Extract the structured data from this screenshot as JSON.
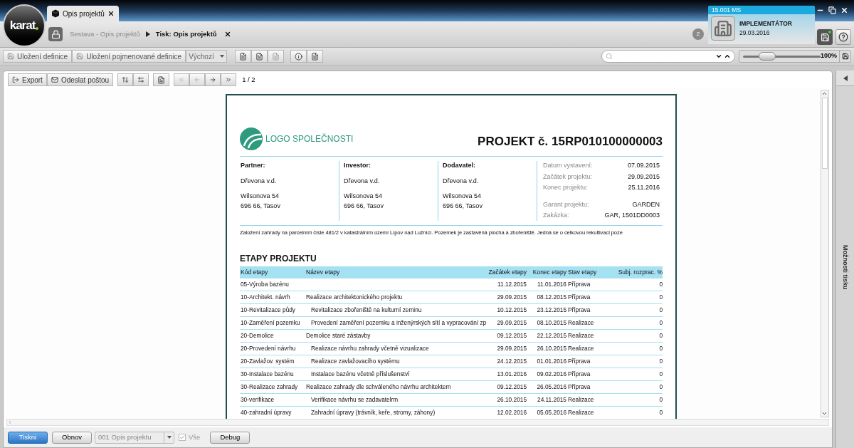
{
  "logo": {
    "text": "karat"
  },
  "tab": {
    "label": "Opis projektů",
    "selected": true
  },
  "breadcrumb": [
    {
      "label": "Sestava - Opis projektů",
      "selected": false
    },
    {
      "label": "Tisk: Opis projektů",
      "selected": true
    }
  ],
  "notifications": {
    "count": "2"
  },
  "user_panel": {
    "server": "15.001 MS",
    "role": "IMPLEMENTÁTOR",
    "date": "29.03.2016"
  },
  "toolbar": {
    "save_definition": "Uložení definice",
    "save_named_definition": "Uložení pojmenované definice",
    "preset": "Výchozí",
    "zoom": {
      "level": 0.25,
      "reading": "100%"
    }
  },
  "viewer_toolbar": {
    "export": "Export",
    "send_mail": "Odeslat poštou",
    "page": "1 / 2"
  },
  "document": {
    "logo_text": "LOGO SPOLEČNOSTI",
    "title": "PROJEKT č. 15RP010100000003",
    "parties": [
      {
        "label": "Partner:",
        "name": "Dřevona v.d.",
        "street": "Wilsonova 54",
        "city": "696 66, Tasov"
      },
      {
        "label": "Investor:",
        "name": "Dřevona v.d.",
        "street": "Wilsonova 54",
        "city": "696 66, Tasov"
      },
      {
        "label": "Dodavatel:",
        "name": "Dřevona v.d.",
        "street": "Wilsonova 54",
        "city": "696 66, Tasov"
      }
    ],
    "info": [
      {
        "label": "Datum vystavení:",
        "value": "07.09.2015"
      },
      {
        "label": "Začátek projektu:",
        "value": "29.09.2015"
      },
      {
        "label": "Konec projektu:",
        "value": "25.11.2016"
      },
      {
        "label": "Garant projektu:",
        "value": "GARDEN"
      },
      {
        "label": "Zakázka:",
        "value": "GAR, 1501DD0003"
      }
    ],
    "description": "Založení zahrady na parcelním čísle 481/2 v katastrálním území Lípov nad Lužnící. Pozemek je zastavěná plocha a zbořeniště. Jedná se o celkovou rekultivaci poze",
    "section_title": "ETAPY PROJEKTU",
    "table": {
      "columns": [
        "Kód etapy",
        "Název etapy",
        "Začátek etapy",
        "Konec etapy",
        "Stav etapy",
        "Subj. rozprac. %"
      ],
      "rows": [
        {
          "code": "05-Výroba bazénu",
          "start": "11.12.2015",
          "end": "11.01.2016",
          "state": "Příprava",
          "progress": "0"
        },
        {
          "code": "10-Architekt. návrh",
          "name": "Realizace architektonického projektu",
          "indented": false,
          "start": "29.09.2015",
          "end": "08.12.2015",
          "state": "Příprava",
          "progress": "0"
        },
        {
          "code": "10-Revitalizace půdy",
          "name": "Revitalizace zbořeniště na kulturní zeminu",
          "indented": true,
          "start": "10.12.2015",
          "end": "23.12.2015",
          "state": "Příprava",
          "progress": "0"
        },
        {
          "code": "10-Zaměření pozemku",
          "name": "Provedení zaměření pozemku a inženýrských sítí a vypracování zp",
          "indented": true,
          "start": "29.09.2015",
          "end": "08.10.2015",
          "state": "Realizace",
          "progress": "0"
        },
        {
          "code": "20-Demolice",
          "name": "Demolice staré zástavby",
          "indented": false,
          "start": "09.12.2015",
          "end": "22.12.2015",
          "state": "Realizace",
          "progress": "0"
        },
        {
          "code": "20-Provedení návrhu",
          "name": "Realizace návrhu zahrady včetně vizualizace",
          "indented": true,
          "start": "29.09.2015",
          "end": "26.10.2015",
          "state": "Realizace",
          "progress": "0"
        },
        {
          "code": "20-Zavlažov. systém",
          "name": "Realizace zavlažovacího systému",
          "indented": true,
          "start": "24.12.2015",
          "end": "01.01.2016",
          "state": "Příprava",
          "progress": "0"
        },
        {
          "code": "30-Instalace bazénu",
          "name": "Instalace bazénu včetně příslušenství",
          "indented": true,
          "start": "13.01.2016",
          "end": "09.02.2016",
          "state": "Příprava",
          "progress": "0"
        },
        {
          "code": "30-Realizace zahrady",
          "name": "Realizace zahrady dle schváleného návrhu architektem",
          "indented": false,
          "start": "09.12.2015",
          "end": "26.05.2016",
          "state": "Příprava",
          "progress": "0"
        },
        {
          "code": "30-verifikace",
          "name": "Verifikace návrhu se zadavatelrm",
          "indented": true,
          "start": "26.10.2015",
          "end": "24.11.2015",
          "state": "Realizace",
          "progress": "0"
        },
        {
          "code": "40-zahradní úpravy",
          "name": "Zahradní úpravy (trávník, keře, stromy, záhony)",
          "indented": true,
          "start": "12.02.2016",
          "end": "05.05.2016",
          "state": "Realizace",
          "progress": "0"
        }
      ]
    }
  },
  "side_panel": {
    "label": "Možnosti tisku"
  },
  "bottom_bar": {
    "print": "Tiskni",
    "refresh": "Obnov",
    "report": "001 Opis projektu",
    "all": {
      "label": "Vše",
      "checked": true
    },
    "debug": "Debug"
  }
}
